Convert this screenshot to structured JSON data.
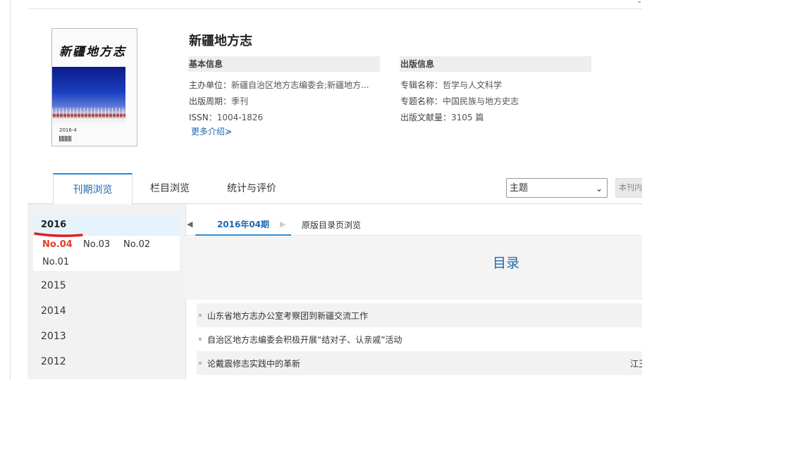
{
  "journal": {
    "title": "新疆地方志",
    "cover_title": "新疆地方志",
    "cover_edition": "2016-4",
    "more_label": "更多介绍≽"
  },
  "basic_info": {
    "heading": "基本信息",
    "rows": [
      {
        "label": "主办单位：",
        "value": "新疆自治区地方志编委会;新疆地方..."
      },
      {
        "label": "出版周期：",
        "value": "季刊"
      },
      {
        "label": "ISSN：",
        "value": "1004-1826"
      }
    ]
  },
  "publish_info": {
    "heading": "出版信息",
    "rows": [
      {
        "label": "专辑名称：",
        "value": "哲学与人文科学"
      },
      {
        "label": "专题名称：",
        "value": "中国民族与地方史志"
      },
      {
        "label": "出版文献量：",
        "value": "3105 篇"
      }
    ]
  },
  "tabs": [
    "刊期浏览",
    "栏目浏览",
    "统计与评价"
  ],
  "search": {
    "select_value": "主题",
    "input_placeholder": "本刊内"
  },
  "years": {
    "active": "2016",
    "issues": [
      "No.04",
      "No.03",
      "No.02",
      "No.01"
    ],
    "current_issue": "No.04",
    "others": [
      "2015",
      "2014",
      "2013",
      "2012"
    ]
  },
  "issue_nav": {
    "current": "2016年04期",
    "orig_label": "原版目录页浏览"
  },
  "toc": {
    "title": "目录",
    "articles": [
      {
        "title": "山东省地方志办公室考察团到新疆交流工作",
        "author": ""
      },
      {
        "title": "自治区地方志编委会积极开展“结对子、认亲戚”活动",
        "author": ""
      },
      {
        "title": "论戴震修志实践中的革新",
        "author": "江玉"
      }
    ]
  },
  "colors": {
    "accent": "#2a8bd8",
    "link": "#1f68b0",
    "current_issue": "#e0402a"
  }
}
